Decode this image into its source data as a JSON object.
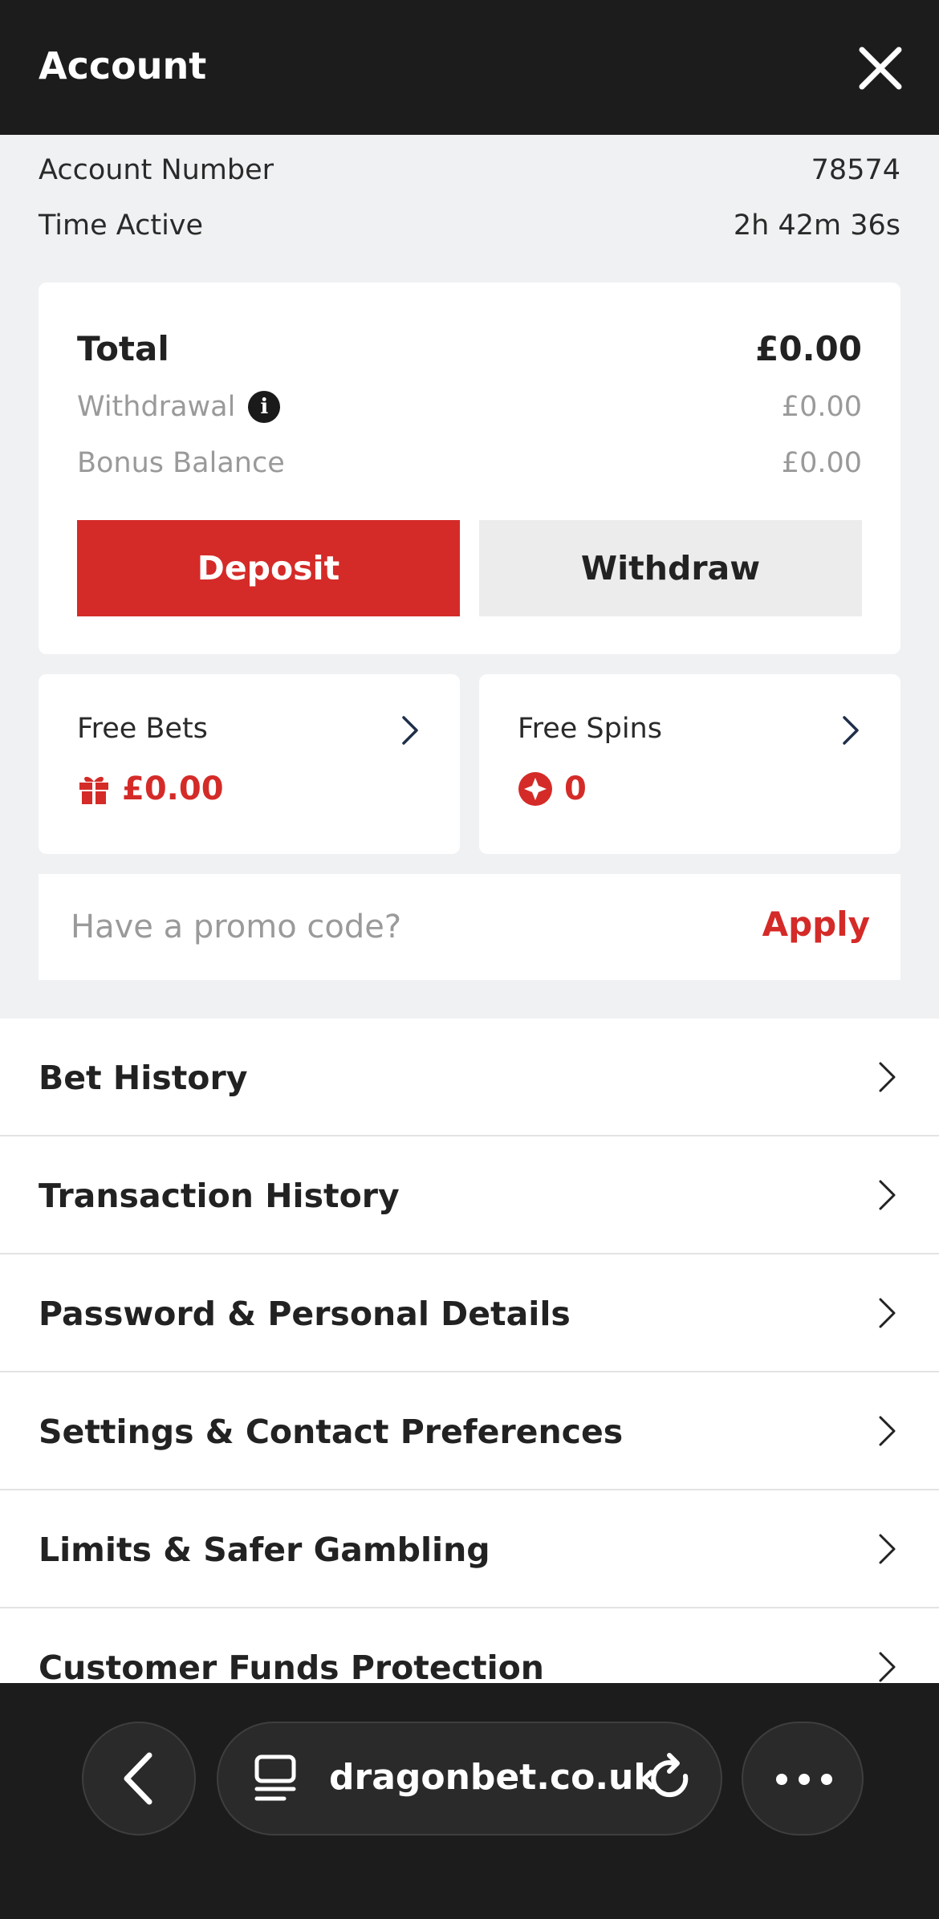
{
  "header": {
    "title": "Account",
    "close_icon": "close-icon"
  },
  "account": {
    "number_label": "Account Number",
    "number_value": "78574",
    "time_label": "Time Active",
    "time_value": "2h 42m 36s"
  },
  "balance": {
    "total_label": "Total",
    "total_value": "£0.00",
    "withdrawal_label": "Withdrawal",
    "withdrawal_value": "£0.00",
    "bonus_label": "Bonus Balance",
    "bonus_value": "£0.00",
    "deposit_label": "Deposit",
    "withdraw_label": "Withdraw"
  },
  "free_bets": {
    "label": "Free Bets",
    "value": "£0.00",
    "icon": "gift-icon"
  },
  "free_spins": {
    "label": "Free Spins",
    "value": "0",
    "icon": "star-badge-icon"
  },
  "promo": {
    "placeholder": "Have a promo code?",
    "apply_label": "Apply"
  },
  "menu": {
    "items": [
      {
        "label": "Bet History"
      },
      {
        "label": "Transaction History"
      },
      {
        "label": "Password & Personal Details"
      },
      {
        "label": "Settings & Contact Preferences"
      },
      {
        "label": "Limits & Safer Gambling"
      },
      {
        "label": "Customer Funds Protection"
      }
    ]
  },
  "browser": {
    "url": "dragonbet.co.uk"
  },
  "colors": {
    "accent": "#d42b28",
    "header_bg": "#1c1c1c",
    "page_bg": "#f0f1f3"
  }
}
